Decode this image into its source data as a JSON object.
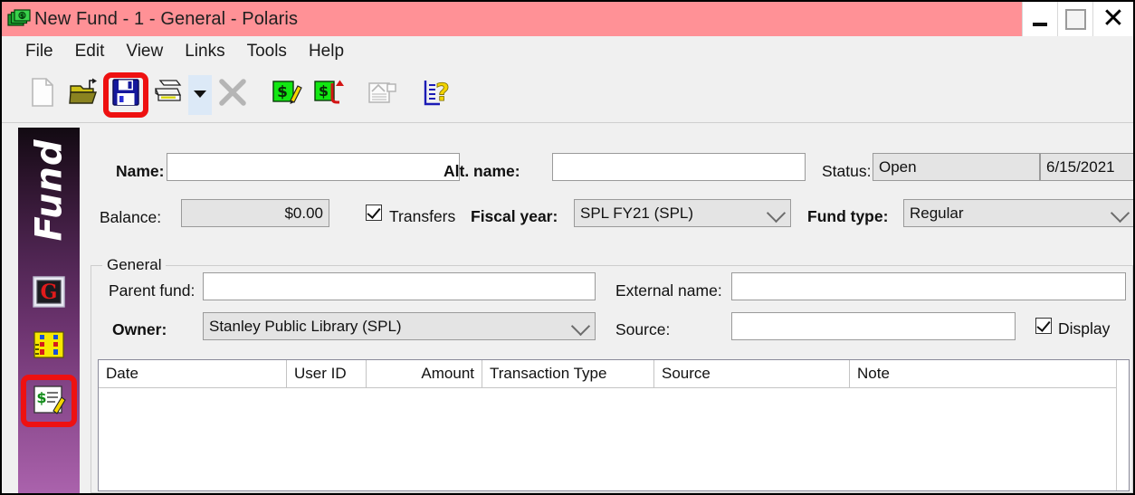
{
  "window": {
    "title": "New Fund - 1 - General - Polaris",
    "icon": "money-stack-icon",
    "titlebar_color": "#ff9196",
    "controls": {
      "minimize": "minimize-icon",
      "maximize": "maximize-icon",
      "close": "close-icon"
    }
  },
  "menu": {
    "items": [
      "File",
      "Edit",
      "View",
      "Links",
      "Tools",
      "Help"
    ]
  },
  "toolbar": {
    "buttons": [
      {
        "name": "new-icon",
        "enabled": false
      },
      {
        "name": "open-folder-icon",
        "enabled": true
      },
      {
        "name": "save-icon",
        "enabled": true,
        "highlighted": true
      },
      {
        "name": "print-icon",
        "enabled": true
      },
      {
        "name": "dropdown-arrow-icon",
        "enabled": true
      },
      {
        "name": "delete-icon",
        "enabled": false
      },
      {
        "name": "edit-fund-icon",
        "enabled": true
      },
      {
        "name": "transfer-fund-icon",
        "enabled": true
      },
      {
        "name": "properties-icon",
        "enabled": false
      },
      {
        "name": "help-icon",
        "enabled": true
      }
    ],
    "highlight_color": "#ee1111"
  },
  "sidebar": {
    "label": "Fund",
    "items": [
      {
        "name": "sidebar-item-general",
        "icon": "red-g-icon"
      },
      {
        "name": "sidebar-item-notes",
        "icon": "yellow-grid-icon"
      },
      {
        "name": "sidebar-item-transactions",
        "icon": "money-document-icon",
        "highlighted": true
      }
    ]
  },
  "form": {
    "name_label": "Name:",
    "name_value": "",
    "alt_name_label": "Alt. name:",
    "alt_name_value": "",
    "status_label": "Status:",
    "status_value": "Open",
    "status_date": "6/15/2021",
    "balance_label": "Balance:",
    "balance_value": "$0.00",
    "transfers_label": "Transfers",
    "transfers_checked": true,
    "fiscal_year_label": "Fiscal year:",
    "fiscal_year_value": "SPL FY21 (SPL)",
    "fund_type_label": "Fund type:",
    "fund_type_value": "Regular"
  },
  "general_group": {
    "title": "General",
    "parent_fund_label": "Parent fund:",
    "parent_fund_value": "",
    "external_name_label": "External name:",
    "external_name_value": "",
    "owner_label": "Owner:",
    "owner_value": "Stanley Public Library (SPL)",
    "source_label": "Source:",
    "source_value": "",
    "display_label": "Display",
    "display_checked": true
  },
  "grid": {
    "columns": [
      {
        "label": "Date",
        "align": "left"
      },
      {
        "label": "User ID",
        "align": "left"
      },
      {
        "label": "Amount",
        "align": "right"
      },
      {
        "label": "Transaction Type",
        "align": "left"
      },
      {
        "label": "Source",
        "align": "left"
      },
      {
        "label": "Note",
        "align": "left"
      }
    ],
    "rows": []
  }
}
